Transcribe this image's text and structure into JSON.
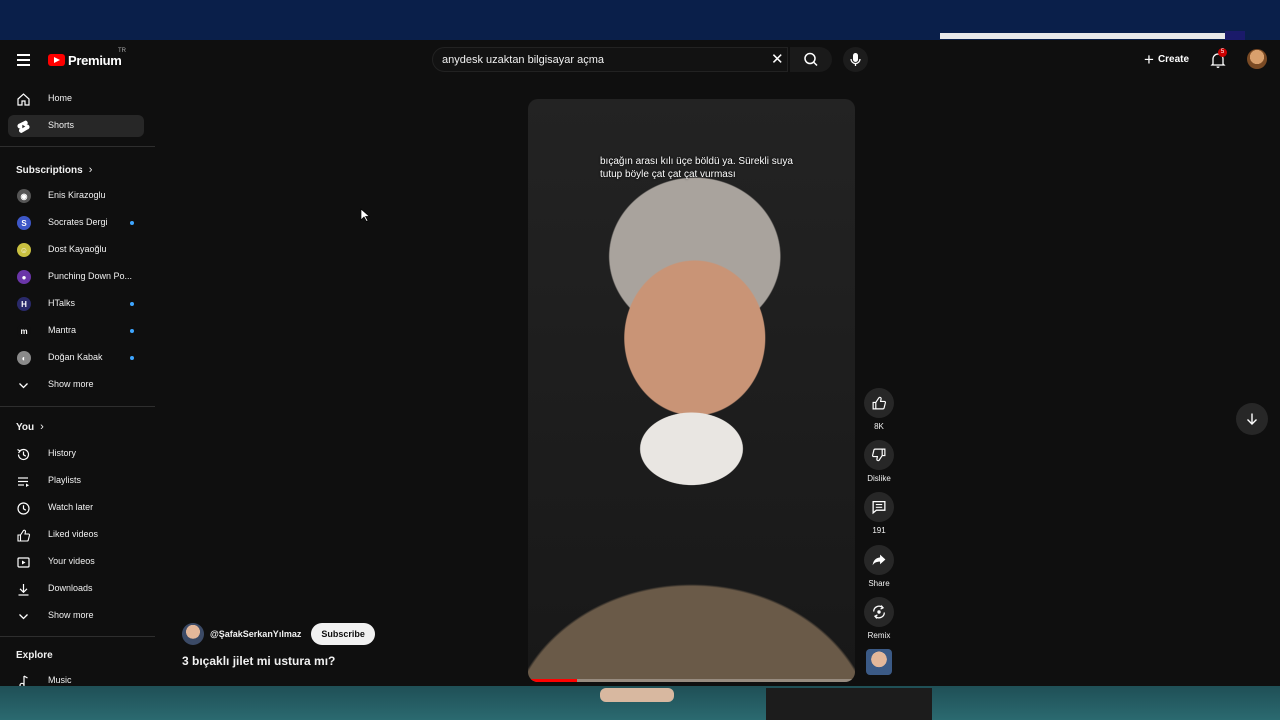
{
  "header": {
    "logo_text": "Premium",
    "logo_country": "TR",
    "search_value": "anydesk uzaktan bilgisayar açma",
    "create_label": "Create",
    "notification_count": "5"
  },
  "sidebar": {
    "main": [
      {
        "label": "Home",
        "icon": "home-icon"
      },
      {
        "label": "Shorts",
        "icon": "shorts-icon"
      }
    ],
    "subscriptions_title": "Subscriptions",
    "subscriptions": [
      {
        "label": "Enis Kirazoglu",
        "new": false,
        "color": "#555555"
      },
      {
        "label": "Socrates Dergi",
        "new": true,
        "color": "#3d57c7"
      },
      {
        "label": "Dost Kayaoğlu",
        "new": false,
        "color": "#c9c040"
      },
      {
        "label": "Punching Down Po...",
        "new": false,
        "color": "#6a35a8"
      },
      {
        "label": "HTalks",
        "new": true,
        "color": "#2a2a6a"
      },
      {
        "label": "Mantra",
        "new": true,
        "color": "#0f0f0f"
      },
      {
        "label": "Doğan Kabak",
        "new": true,
        "color": "#8a8a8a"
      }
    ],
    "show_more_1": "Show more",
    "you_title": "You",
    "you_items": [
      {
        "label": "History",
        "icon": "history-icon"
      },
      {
        "label": "Playlists",
        "icon": "playlists-icon"
      },
      {
        "label": "Watch later",
        "icon": "watch-later-icon"
      },
      {
        "label": "Liked videos",
        "icon": "liked-videos-icon"
      },
      {
        "label": "Your videos",
        "icon": "your-videos-icon"
      },
      {
        "label": "Downloads",
        "icon": "downloads-icon"
      }
    ],
    "show_more_2": "Show more",
    "explore_title": "Explore",
    "explore_items": [
      {
        "label": "Music",
        "icon": "music-icon"
      }
    ]
  },
  "short": {
    "caption": "bıçağın arası kılı üçe böldü ya. Sürekli suya tutup böyle çat çat çat vurması",
    "channel": "@ŞafakSerkanYılmaz",
    "subscribe_label": "Subscribe",
    "title": "3 bıçaklı jilet mi ustura mı?",
    "progress": 0.15
  },
  "actions": {
    "like_count": "8K",
    "dislike_label": "Dislike",
    "comment_count": "191",
    "share_label": "Share",
    "remix_label": "Remix"
  },
  "colors": {
    "accent_red": "#ff0000",
    "new_dot": "#3ea6ff",
    "background": "#0f0f0f"
  }
}
